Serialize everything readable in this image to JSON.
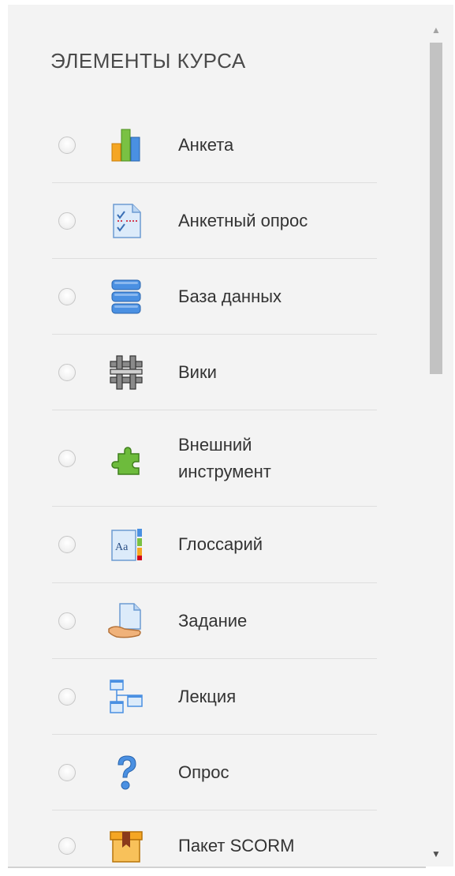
{
  "section": {
    "title": "ЭЛЕМЕНТЫ КУРСА"
  },
  "items": [
    {
      "label": "Анкета",
      "icon": "feedback-chart-icon"
    },
    {
      "label": "Анкетный опрос",
      "icon": "survey-icon"
    },
    {
      "label": "База данных",
      "icon": "database-icon"
    },
    {
      "label": "Вики",
      "icon": "wiki-icon"
    },
    {
      "label_line1": "Внешний",
      "label_line2": "инструмент",
      "icon": "puzzle-icon"
    },
    {
      "label": "Глоссарий",
      "icon": "glossary-icon"
    },
    {
      "label": "Задание",
      "icon": "assignment-icon"
    },
    {
      "label": "Лекция",
      "icon": "lesson-icon"
    },
    {
      "label": "Опрос",
      "icon": "question-icon"
    },
    {
      "label": "Пакет SCORM",
      "icon": "scorm-package-icon"
    }
  ],
  "scrollbar": {
    "up_glyph": "▲",
    "down_glyph": "▼"
  },
  "colors": {
    "panel_bg": "#f3f3f3",
    "text": "#333333",
    "divider": "#dedede",
    "scroll_thumb": "#c2c2c2"
  }
}
